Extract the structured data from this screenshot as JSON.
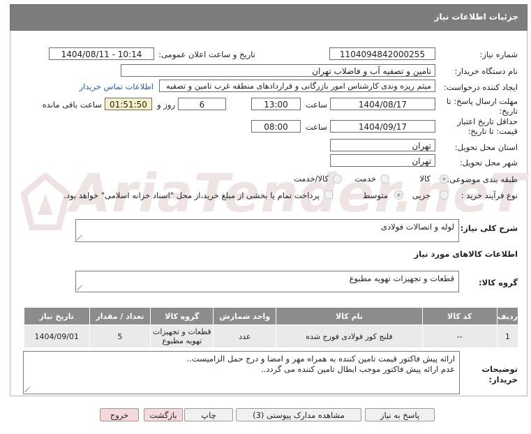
{
  "header": {
    "title": "جزئیات اطلاعات نیاز"
  },
  "watermark": {
    "text": "AriaTender.neT"
  },
  "form": {
    "need_number_label": "شماره نیاز:",
    "need_number": "1104094842000255",
    "announce_label": "تاریخ و ساعت اعلان عمومی:",
    "announce_value": "1404/08/11 - 10:14",
    "buyer_org_label": "نام دستگاه خریدار:",
    "buyer_org": "تامین و تصفیه آب و فاضلاب تهران",
    "requester_label": "ایجاد کننده درخواست:",
    "requester": "میثم ریزه وندی کارشناس امور بازرگانی و قراردادهای منطقه غرب تامین و تصفیه",
    "contact_link": "اطلاعات تماس خریدار",
    "deadline_label_1": "مهلت ارسال پاسخ: تا",
    "deadline_label_2": "تاریخ:",
    "deadline_date": "1404/08/17",
    "time_label": "ساعت",
    "deadline_time": "13:00",
    "days_value": "6",
    "days_label": "روز و",
    "remaining_value": "01:51:50",
    "remaining_label": "ساعت باقی مانده",
    "validity_label_1": "حداقل تاریخ اعتبار",
    "validity_label_2": "قیمت: تا تاریخ:",
    "validity_date": "1404/09/17",
    "validity_time": "08:00",
    "province_label": "استان محل تحویل:",
    "province": "تهران",
    "city_label": "شهر محل تحویل:",
    "city": "تهران",
    "category_label": "طبقه بندی موضوعی:",
    "category_options": [
      "کالا",
      "خدمت",
      "کالا/خدمت"
    ],
    "process_label": "نوع فرآیند خرید :",
    "process_options": [
      "جزیی",
      "متوسط"
    ],
    "payment_note": "پرداخت تمام یا بخشی از مبلغ خرید،از محل \"اسناد خزانه اسلامی\" خواهد بود."
  },
  "summary": {
    "label": "شرح کلی نیاز:",
    "value": "لوله و اتصالات فولادی"
  },
  "goods_section": {
    "title": "اطلاعات کالاهای مورد نیاز",
    "group_label": "گروه کالا:",
    "group_value": "قطعات و تجهیزات تهویه مطبوع"
  },
  "table": {
    "headers": [
      "ردیف",
      "کد کالا",
      "نام کالا",
      "واحد شمارش",
      "گروه کالا",
      "تعداد / مقدار",
      "تاریخ نیاز"
    ],
    "rows": [
      [
        "1",
        "--",
        "فلنج کور فولادی فورج شده",
        "عدد",
        "قطعات و تجهیزات تهویه مطبوع",
        "5",
        "1404/09/01"
      ]
    ]
  },
  "notes": {
    "label_1": "توضیحات",
    "label_2": "خریدار:",
    "line_1": "ارائه پیش فاکتور قیمت تامین کننده به همراه مهر و امضا و درج حمل الزامیست..",
    "line_2": "عدم ارائه پیش فاکتور موجب ابطال تامین کننده می گردد.."
  },
  "buttons": {
    "reply": "پاسخ به نیاز",
    "docs": "مشاهده مدارک پیوستی (3)",
    "print": "چاپ",
    "back": "بازگشت",
    "exit": "خروج"
  }
}
